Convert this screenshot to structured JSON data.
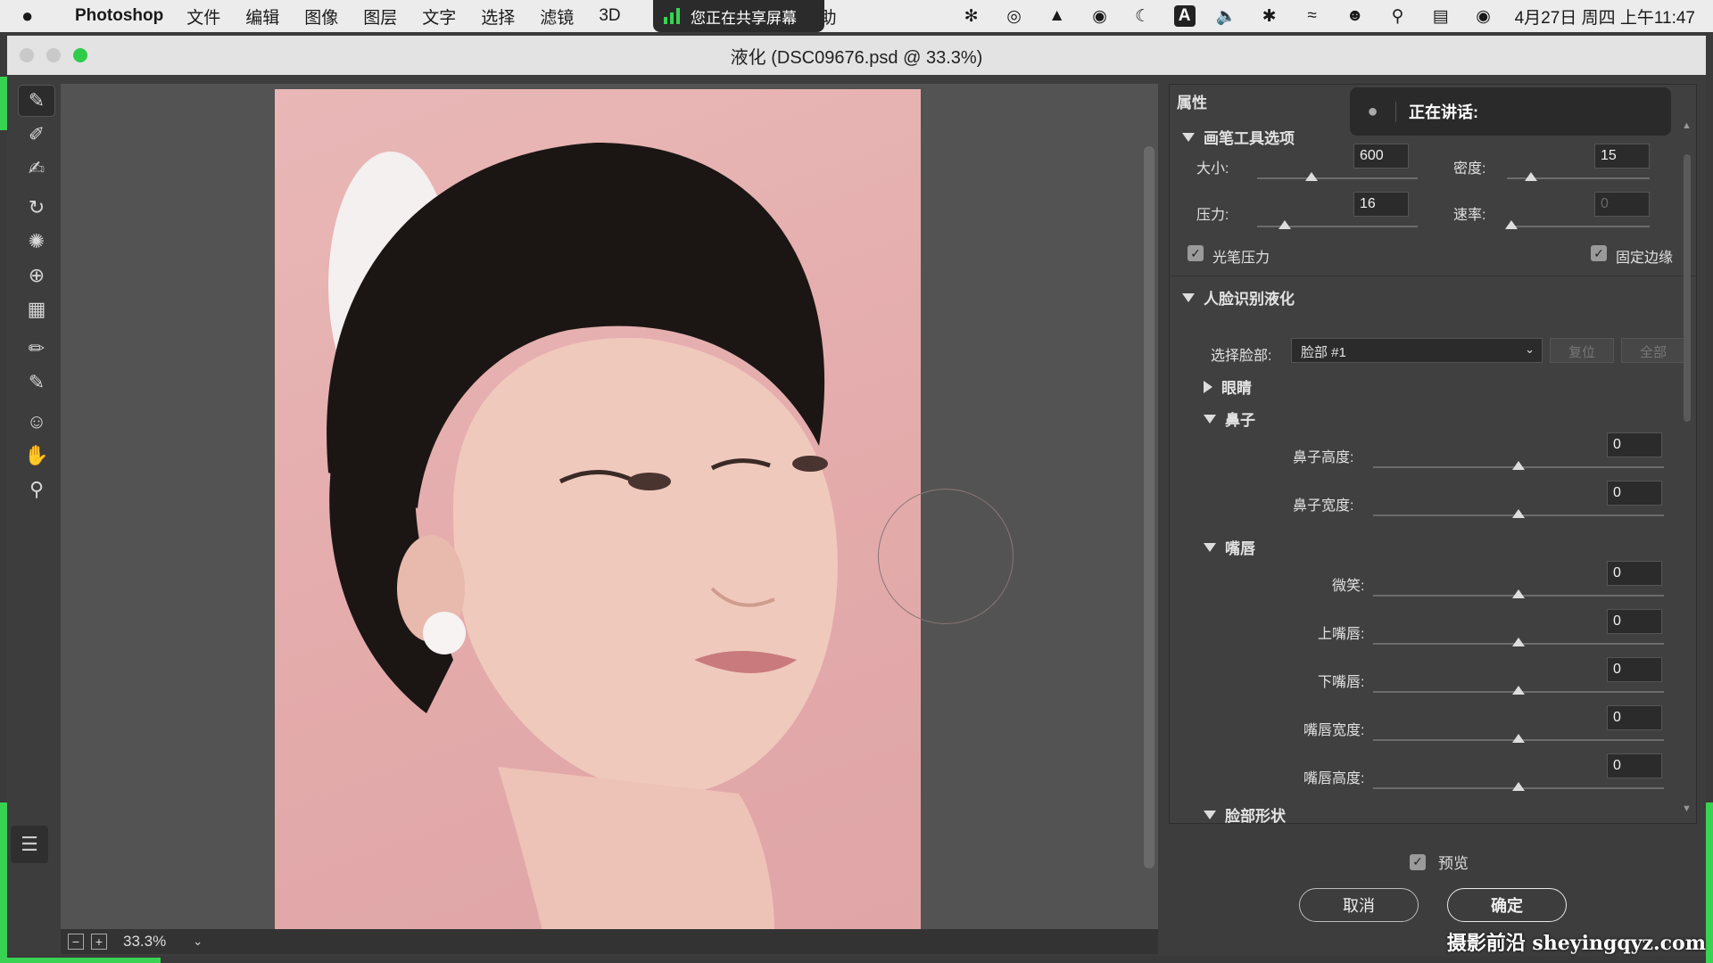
{
  "menubar": {
    "apple_icon": "",
    "app_name": "Photoshop",
    "items": [
      "文件",
      "编辑",
      "图像",
      "图层",
      "文字",
      "选择",
      "滤镜",
      "3D",
      "帮助"
    ],
    "share_banner": "您正在共享屏幕",
    "status_icons": [
      "app-icon-1",
      "app-icon-2",
      "app-icon-3",
      "app-icon-4",
      "moon-icon",
      "input-method-icon",
      "volume-icon",
      "bluetooth-icon",
      "wifi-icon",
      "user-icon",
      "search-icon",
      "control-center-icon",
      "siri-icon"
    ],
    "input_method": "A",
    "clock": "4月27日 周四 上午11:47"
  },
  "window": {
    "title": "液化 (DSC09676.psd @ 33.3%)"
  },
  "tools": [
    "forward-warp-tool-icon",
    "reconstruct-tool-icon",
    "smooth-tool-icon",
    "twirl-tool-icon",
    "pucker-tool-icon",
    "bloat-tool-icon",
    "push-left-tool-icon",
    "freeze-mask-tool-icon",
    "thaw-mask-tool-icon",
    "face-tool-icon",
    "hand-tool-icon",
    "zoom-tool-icon"
  ],
  "status": {
    "zoom_minus": "−",
    "zoom_plus": "+",
    "zoom": "33.3%"
  },
  "speaking": {
    "label": "正在讲话:"
  },
  "properties": {
    "title": "属性",
    "brush_section": "画笔工具选项",
    "size_label": "大小:",
    "size_value": "600",
    "density_label": "密度:",
    "density_value": "15",
    "pressure_label": "压力:",
    "pressure_value": "16",
    "rate_label": "速率:",
    "rate_value": "0",
    "stylus_label": "光笔压力",
    "pin_edges_label": "固定边缘",
    "face_section": "人脸识别液化",
    "select_face_label": "选择脸部:",
    "select_face_value": "脸部 #1",
    "reset_label": "复位",
    "all_label": "全部",
    "eyes_label": "眼睛",
    "nose_label": "鼻子",
    "nose_height_label": "鼻子高度:",
    "nose_height_value": "0",
    "nose_width_label": "鼻子宽度:",
    "nose_width_value": "0",
    "mouth_label": "嘴唇",
    "smile_label": "微笑:",
    "smile_value": "0",
    "upper_lip_label": "上嘴唇:",
    "upper_lip_value": "0",
    "lower_lip_label": "下嘴唇:",
    "lower_lip_value": "0",
    "mouth_width_label": "嘴唇宽度:",
    "mouth_width_value": "0",
    "mouth_height_label": "嘴唇高度:",
    "mouth_height_value": "0",
    "face_shape_label": "脸部形状"
  },
  "footer": {
    "preview_label": "预览",
    "cancel_label": "取消",
    "ok_label": "确定"
  },
  "watermark": "摄影前沿 sheyingqyz.com"
}
